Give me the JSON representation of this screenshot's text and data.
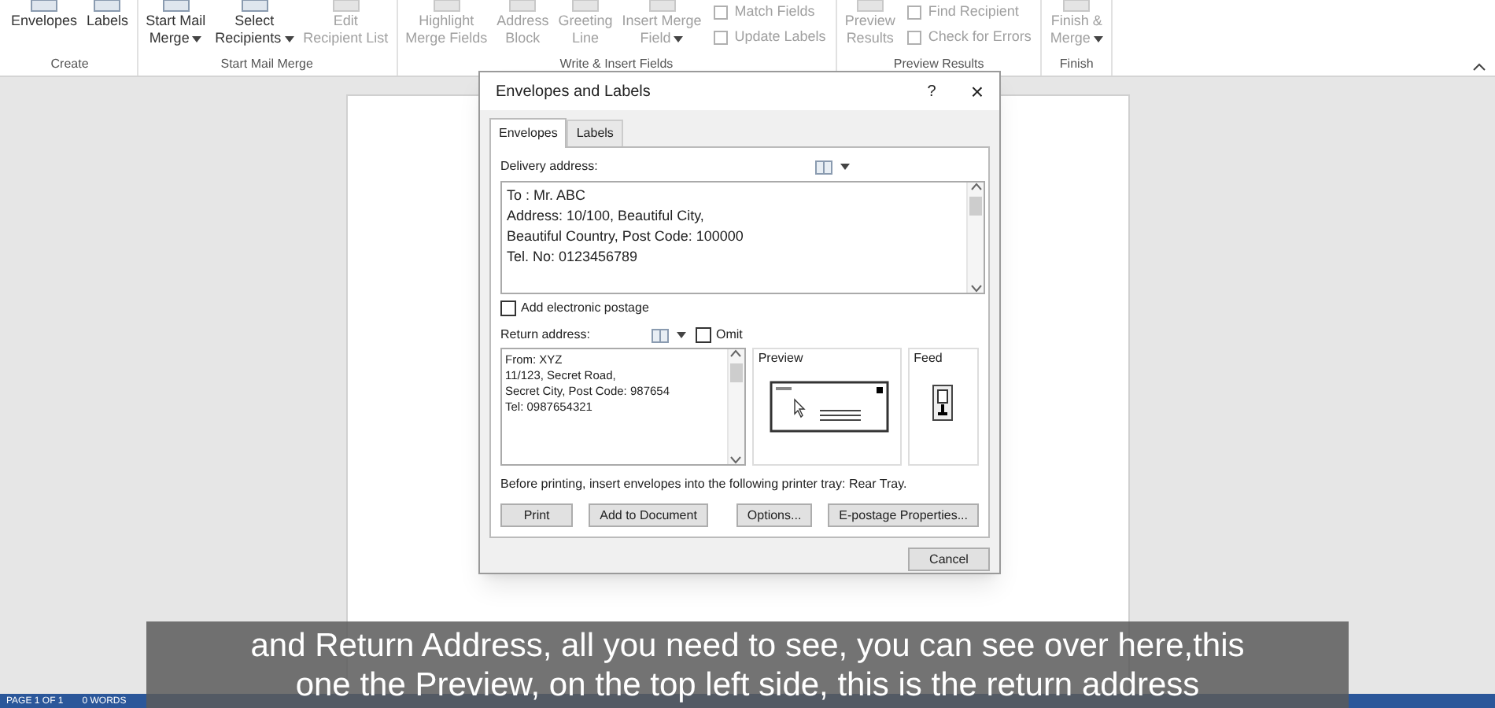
{
  "ribbon": {
    "groups": [
      {
        "label": "Create",
        "buttons": [
          {
            "kind": "large",
            "lines": [
              "Envelopes"
            ],
            "dropdown": false,
            "disabled": false
          },
          {
            "kind": "large",
            "lines": [
              "Labels"
            ],
            "dropdown": false,
            "disabled": false
          }
        ]
      },
      {
        "label": "Start Mail Merge",
        "buttons": [
          {
            "kind": "large",
            "lines": [
              "Start Mail",
              "Merge"
            ],
            "dropdown": true,
            "disabled": false
          },
          {
            "kind": "large",
            "lines": [
              "Select",
              "Recipients"
            ],
            "dropdown": true,
            "disabled": false
          },
          {
            "kind": "large",
            "lines": [
              "Edit",
              "Recipient List"
            ],
            "dropdown": false,
            "disabled": true
          }
        ]
      },
      {
        "label": "Write & Insert Fields",
        "buttons": [
          {
            "kind": "large",
            "lines": [
              "Highlight",
              "Merge Fields"
            ],
            "dropdown": false,
            "disabled": true
          },
          {
            "kind": "large",
            "lines": [
              "Address",
              "Block"
            ],
            "dropdown": false,
            "disabled": true
          },
          {
            "kind": "large",
            "lines": [
              "Greeting",
              "Line"
            ],
            "dropdown": false,
            "disabled": true
          },
          {
            "kind": "large",
            "lines": [
              "Insert Merge",
              "Field"
            ],
            "dropdown": true,
            "disabled": true
          },
          {
            "kind": "small",
            "lines": [
              "Match Fields",
              "Update Labels"
            ],
            "disabled": true
          }
        ]
      },
      {
        "label": "Preview Results",
        "buttons": [
          {
            "kind": "large",
            "lines": [
              "Preview",
              "Results"
            ],
            "dropdown": false,
            "disabled": true
          },
          {
            "kind": "small",
            "lines": [
              "Find Recipient",
              "Check for Errors"
            ],
            "disabled": true
          }
        ]
      },
      {
        "label": "Finish",
        "buttons": [
          {
            "kind": "large",
            "lines": [
              "Finish &",
              "Merge"
            ],
            "dropdown": true,
            "disabled": true
          }
        ]
      }
    ]
  },
  "dialog": {
    "title": "Envelopes and Labels",
    "help": "?",
    "close": "×",
    "tabs": [
      {
        "label": "Envelopes",
        "selected": true
      },
      {
        "label": "Labels",
        "selected": false
      }
    ],
    "delivery": {
      "label": "Delivery address:",
      "lines": [
        "To : Mr. ABC",
        "Address: 10/100, Beautiful City,",
        "Beautiful Country, Post Code: 100000",
        "Tel. No: 0123456789"
      ]
    },
    "add_postage": {
      "label": "Add electronic postage",
      "checked": false
    },
    "return": {
      "label": "Return address:",
      "omit": {
        "label": "Omit",
        "checked": false
      },
      "lines": [
        "From: XYZ",
        "11/123, Secret Road,",
        "Secret City, Post Code: 987654",
        "Tel: 0987654321"
      ]
    },
    "preview": {
      "label": "Preview"
    },
    "feed": {
      "label": "Feed"
    },
    "note": "Before printing, insert envelopes into the following printer tray: Rear Tray.",
    "buttons": [
      "Print",
      "Add to Document",
      "Options...",
      "E-postage Properties..."
    ],
    "cancel": "Cancel"
  },
  "status_bar": {
    "items": [
      "PAGE 1 OF 1",
      "0 WORDS"
    ]
  },
  "subtitle": {
    "lines": [
      "and Return Address, all you need to see, you can see over here,this",
      "one the Preview, on the top left side, this is the return address"
    ]
  }
}
